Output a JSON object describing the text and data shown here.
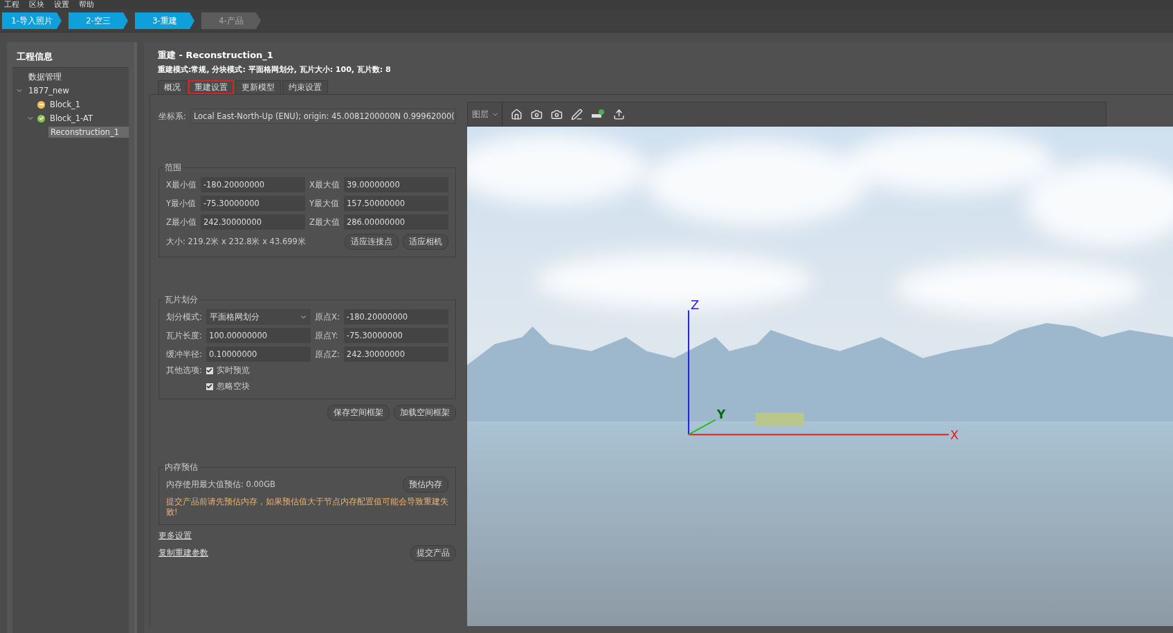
{
  "menu": [
    "工程",
    "区块",
    "设置",
    "帮助"
  ],
  "steps": [
    {
      "label": "1-导入照片",
      "done": true
    },
    {
      "label": "2-空三",
      "done": true
    },
    {
      "label": "3-重建",
      "done": true
    },
    {
      "label": "4-产品",
      "done": false
    }
  ],
  "sidebar": {
    "title": "工程信息",
    "tree": [
      {
        "label": "数据管理",
        "selected": false
      },
      {
        "label": "1877_new",
        "expanded": true,
        "selected": false,
        "children": [
          {
            "label": "Block_1",
            "kind": "pending",
            "selected": false
          },
          {
            "label": "Block_1-AT",
            "kind": "done",
            "expanded": true,
            "selected": false,
            "children": [
              {
                "label": "Reconstruction_1",
                "selected": true
              }
            ]
          }
        ]
      }
    ]
  },
  "header": {
    "title": "重建 - Reconstruction_1",
    "subtitle": "重建模式:常规, 分块模式: 平面格网划分, 瓦片大小: 100, 瓦片数: 8"
  },
  "tabs": [
    {
      "label": "概况",
      "selected": false
    },
    {
      "label": "重建设置",
      "selected": true
    },
    {
      "label": "更新模型",
      "selected": false
    },
    {
      "label": "约束设置",
      "selected": false
    }
  ],
  "coord": {
    "label": "坐标系:",
    "value": "Local East-North-Up (ENU); origin: 45.0081200000N 0.99962000("
  },
  "range": {
    "title": "范围",
    "fields": [
      {
        "label": "X最小值",
        "value": "-180.20000000"
      },
      {
        "label": "X最大值",
        "value": "39.00000000"
      },
      {
        "label": "Y最小值",
        "value": "-75.30000000"
      },
      {
        "label": "Y最大值",
        "value": "157.50000000"
      },
      {
        "label": "Z最小值",
        "value": "242.30000000"
      },
      {
        "label": "Z最大值",
        "value": "286.00000000"
      }
    ],
    "size": "大小: 219.2米 x 232.8米 x 43.699米",
    "buttons": [
      "适应连接点",
      "适应相机"
    ]
  },
  "tiling": {
    "title": "瓦片划分",
    "mode_label": "划分模式:",
    "mode": "平面格网划分",
    "left": [
      {
        "label": "瓦片长度:",
        "value": "100.00000000"
      },
      {
        "label": "缓冲半径:",
        "value": "0.10000000"
      }
    ],
    "right": [
      {
        "label": "原点X:",
        "value": "-180.20000000"
      },
      {
        "label": "原点Y:",
        "value": "-75.30000000"
      },
      {
        "label": "原点Z:",
        "value": "242.30000000"
      }
    ],
    "options_label": "其他选项:",
    "options": [
      {
        "label": "实时预览",
        "checked": true
      },
      {
        "label": "忽略空块",
        "checked": true
      }
    ],
    "buttons": [
      "保存空间框架",
      "加载空间框架"
    ]
  },
  "memory": {
    "title": "内存预估",
    "estimate": "内存使用最大值预估: 0.00GB",
    "button": "预估内存",
    "warning": "提交产品前请先预估内存，如果预估值大于节点内存配置值可能会导致重建失败!"
  },
  "links": [
    "更多设置",
    "复制重建参数"
  ],
  "submit": "提交产品",
  "viewer": {
    "layers": "图层",
    "axes": {
      "x": "X",
      "y": "Y",
      "z": "Z"
    }
  }
}
